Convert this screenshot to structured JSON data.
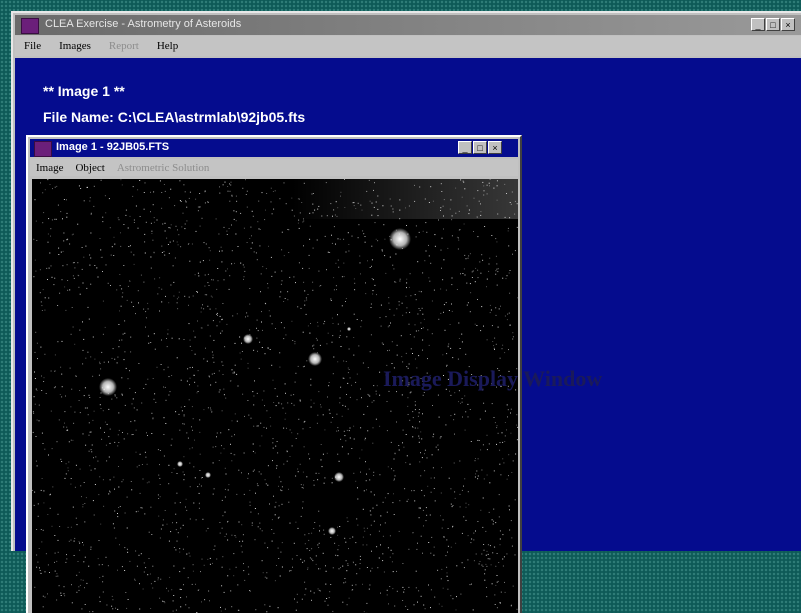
{
  "main_window": {
    "title": "CLEA Exercise - Astrometry of Asteroids",
    "menu": [
      {
        "label": "File",
        "enabled": true
      },
      {
        "label": "Images",
        "enabled": true
      },
      {
        "label": "Report",
        "enabled": false
      },
      {
        "label": "Help",
        "enabled": true
      }
    ],
    "buttons": {
      "minimize": "_",
      "maximize": "□",
      "close": "×"
    },
    "client": {
      "heading": "** Image 1 **",
      "file_name": "File Name: C:\\CLEA\\astrmlab\\92jb05.fts"
    }
  },
  "image_window": {
    "title": "Image 1 - 92JB05.FTS",
    "menu": [
      {
        "label": "Image",
        "enabled": true
      },
      {
        "label": "Object",
        "enabled": true
      },
      {
        "label": "Astrometric Solution",
        "enabled": false
      }
    ],
    "buttons": {
      "minimize": "_",
      "maximize": "□",
      "close": "×"
    }
  },
  "callout_label": "Image Display Window",
  "colors": {
    "client_background": "#050c8e",
    "active_titlebar": "#050c8e",
    "inactive_titlebar": "#8a8a8a",
    "desktop": "#0d5a57",
    "callout_text": "#1a1a5a"
  }
}
